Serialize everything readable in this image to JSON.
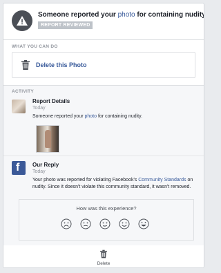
{
  "header": {
    "title_before": "Someone reported your ",
    "title_link": "photo",
    "title_after": " for containing nudity.",
    "badge": "REPORT REVIEWED",
    "icon": "warning-icon"
  },
  "actions": {
    "section_label": "WHAT YOU CAN DO",
    "delete_label": "Delete this Photo",
    "icon": "trash-icon"
  },
  "activity": {
    "section_label": "ACTIVITY",
    "report": {
      "title": "Report Details",
      "time": "Today",
      "body_before": "Someone reported your ",
      "body_link": "photo",
      "body_after": " for containing nudity."
    },
    "reply": {
      "title": "Our Reply",
      "time": "Today",
      "body_before": "Your photo was reported for violating Facebook's ",
      "body_link": "Community Standards",
      "body_after": " on nudity. Since it doesn't violate this community standard, it wasn't removed."
    },
    "survey": {
      "question": "How was this experience?",
      "faces": [
        "very-sad-face-icon",
        "sad-face-icon",
        "neutral-face-icon",
        "happy-face-icon",
        "very-happy-face-icon"
      ]
    }
  },
  "footer": {
    "delete_label": "Delete",
    "icon": "trash-icon"
  },
  "colors": {
    "link": "#365899",
    "badge": "#bec3c9",
    "facebook_blue": "#3b5998",
    "background": "#e9ebee"
  }
}
